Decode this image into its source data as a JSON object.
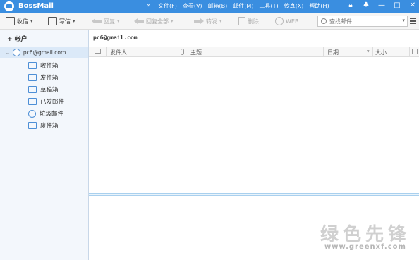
{
  "app": {
    "title": "BossMail",
    "more": "»"
  },
  "menu": [
    {
      "label": "文件(F)"
    },
    {
      "label": "查看(V)"
    },
    {
      "label": "邮箱(B)"
    },
    {
      "label": "邮件(M)"
    },
    {
      "label": "工具(T)"
    },
    {
      "label": "传真(X)"
    },
    {
      "label": "帮助(H)"
    }
  ],
  "toolbar": {
    "receive": "收信",
    "compose": "写信",
    "reply": "回复",
    "reply_all": "回复全部",
    "forward": "转发",
    "delete": "删除",
    "web": "WEB",
    "search_placeholder": "查找邮件..."
  },
  "sidebar": {
    "add_account": "+ 帐户",
    "account": "pc6@gmail.com",
    "folders": [
      {
        "label": "收件箱",
        "icon": "inbox-icon"
      },
      {
        "label": "发件箱",
        "icon": "outbox-icon"
      },
      {
        "label": "草稿箱",
        "icon": "drafts-icon"
      },
      {
        "label": "已发邮件",
        "icon": "sent-icon"
      },
      {
        "label": "垃圾邮件",
        "icon": "spam-icon"
      },
      {
        "label": "废件箱",
        "icon": "trash-icon"
      }
    ]
  },
  "main": {
    "title": "pc6@gmail.com",
    "columns": {
      "sender": "发件人",
      "subject": "主题",
      "date": "日期",
      "size": "大小"
    }
  },
  "watermark": {
    "text": "绿色先锋",
    "url": "www.greenxf.com"
  },
  "colors": {
    "titlebar": "#3a8ee0",
    "accent": "#4d8fd6",
    "selected_row": "#dbe9f8"
  }
}
